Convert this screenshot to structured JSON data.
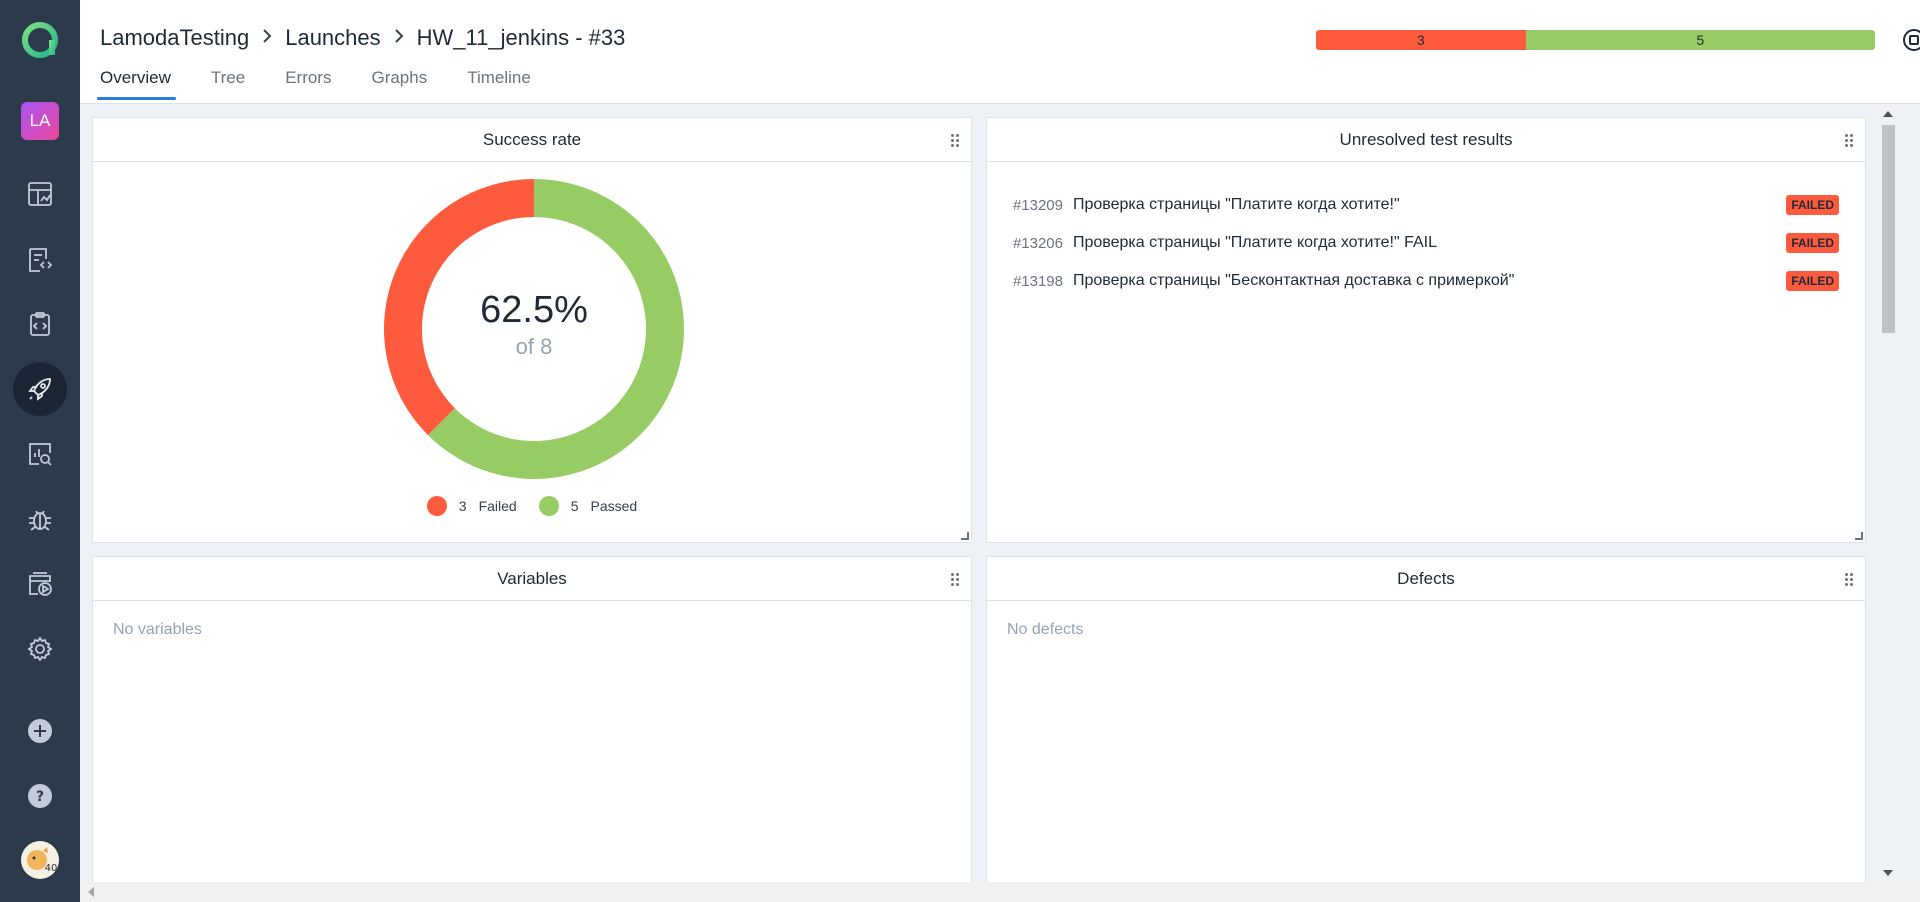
{
  "sidebar": {
    "avatar_initials": "LA",
    "items": [
      {
        "icon": "dashboard-icon"
      },
      {
        "icon": "test-cases-icon"
      },
      {
        "icon": "test-plans-icon"
      },
      {
        "icon": "launches-icon",
        "active": true
      },
      {
        "icon": "analytics-icon"
      },
      {
        "icon": "defects-icon"
      },
      {
        "icon": "jobs-icon"
      },
      {
        "icon": "settings-icon"
      },
      {
        "icon": "add-icon"
      },
      {
        "icon": "help-icon"
      }
    ],
    "user_badge": "40"
  },
  "header": {
    "breadcrumb": [
      "LamodaTesting",
      "Launches",
      "HW_11_jenkins - #33"
    ],
    "tabs": [
      "Overview",
      "Tree",
      "Errors",
      "Graphs",
      "Timeline"
    ],
    "active_tab": "Overview",
    "stats": {
      "failed": 3,
      "passed": 5
    }
  },
  "colors": {
    "failed": "#fd5a3e",
    "passed": "#97cc64",
    "accent": "#2c7be5",
    "sidebar": "#2d3a4b"
  },
  "success_rate": {
    "title": "Success rate",
    "percent": "62.5%",
    "of_label": "of 8",
    "failed": 3,
    "passed": 5,
    "failed_label": "Failed",
    "passed_label": "Passed"
  },
  "unresolved": {
    "title": "Unresolved test results",
    "rows": [
      {
        "id": "#13209",
        "name": "Проверка страницы \"Платите когда хотите!\"",
        "status": "FAILED"
      },
      {
        "id": "#13206",
        "name": "Проверка страницы \"Платите когда хотите!\" FAIL",
        "status": "FAILED"
      },
      {
        "id": "#13198",
        "name": "Проверка страницы \"Бесконтактная доставка с примеркой\"",
        "status": "FAILED"
      }
    ]
  },
  "variables": {
    "title": "Variables",
    "empty": "No variables"
  },
  "defects": {
    "title": "Defects",
    "empty": "No defects"
  }
}
